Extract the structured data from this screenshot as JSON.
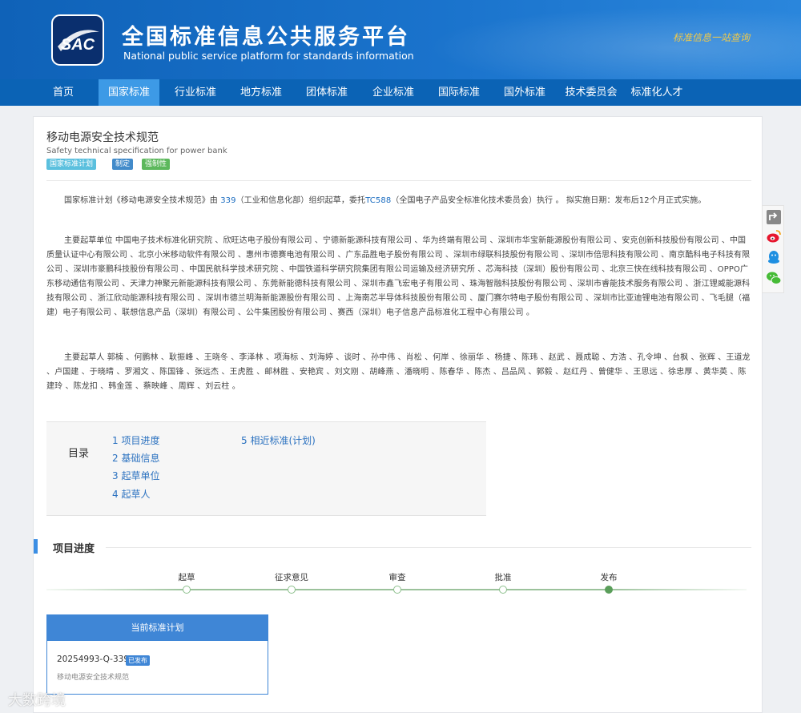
{
  "header": {
    "logo_text": "SAC",
    "title": "全国标准信息公共服务平台",
    "subtitle": "National public service platform  for standards information",
    "slogan": "标准信息一站查询"
  },
  "nav": {
    "items": [
      "首页",
      "国家标准",
      "行业标准",
      "地方标准",
      "团体标准",
      "企业标准",
      "国际标准",
      "国外标准",
      "技术委员会",
      "标准化人才"
    ],
    "active_index": 1
  },
  "standard": {
    "title": "移动电源安全技术规范",
    "title_en": "Safety technical specification for power bank",
    "tags": [
      "国家标准计划",
      "制定",
      "强制性"
    ],
    "tag_colors": [
      "#5bc0de",
      "#428bca",
      "#5cb85c"
    ]
  },
  "intro": {
    "p1_a": "国家标准计划《移动电源安全技术规范》由 ",
    "p1_link1": "339",
    "p1_b": "（工业和信息化部）组织起草，委托",
    "p1_link2": "TC588",
    "p1_c": "（全国电子产品安全标准化技术委员会）执行 。 拟实施日期：发布后12个月正式实施。",
    "units": "主要起草单位 中国电子技术标准化研究院 、欣旺达电子股份有限公司 、宁德新能源科技有限公司 、华为终端有限公司 、深圳市华宝新能源股份有限公司 、安克创新科技股份有限公司 、中国质量认证中心有限公司 、北京小米移动软件有限公司 、惠州市德赛电池有限公司 、广东品胜电子股份有限公司 、深圳市绿联科技股份有限公司 、深圳市倍思科技有限公司 、南京酷科电子科技有限公司 、深圳市豪鹏科技股份有限公司 、中国民航科学技术研究院 、中国铁道科学研究院集团有限公司运输及经济研究所 、芯海科技（深圳）股份有限公司 、北京三快在线科技有限公司 、OPPO广东移动通信有限公司 、天津力神聚元新能源科技有限公司 、东莞新能德科技有限公司 、深圳市鑫飞宏电子有限公司 、珠海智融科技股份有限公司 、深圳市睿能技术服务有限公司 、浙江锂威能源科技有限公司 、浙江欣动能源科技有限公司 、深圳市德兰明海新能源股份有限公司 、上海南芯半导体科技股份有限公司 、厦门赛尔特电子股份有限公司 、深圳市比亚迪锂电池有限公司 、飞毛腿（福建）电子有限公司 、联想信息产品（深圳）有限公司 、公牛集团股份有限公司 、赛西（深圳）电子信息产品标准化工程中心有限公司 。",
    "people": "主要起草人 郭楠 、何鹏林 、耿振峰 、王晓冬 、李泽林 、项海标 、刘海婷 、谈时 、孙中伟 、肖松 、何岸 、徐丽华 、杨捷 、陈玮 、赵武 、聂成聪 、方浩 、孔令坤 、台枫 、张辉 、王道龙 、卢国建 、于晓晴 、罗湘文 、陈国锋 、张远杰 、王虎胜 、邮林胜 、安艳宾 、刘文刚 、胡峰燕 、潘晓明 、陈春华 、陈杰 、吕品风 、郭毅 、赵红丹 、曾健华 、王思远 、徐忠厚 、黄华英 、陈建玲 、陈龙扣 、韩金莲 、蔡映峰 、周辉 、刘云柱 。"
  },
  "toc": {
    "label": "目录",
    "items": [
      "1  项目进度",
      "2  基础信息",
      "3  起草单位",
      "4  起草人",
      "5  相近标准(计划)"
    ]
  },
  "progress": {
    "section_title": "项目进度",
    "steps": [
      "起草",
      "征求意见",
      "审查",
      "批准",
      "发布"
    ],
    "current_step_index": 4
  },
  "plan_card": {
    "header": "当前标准计划",
    "code": "20254993-Q-339",
    "badge": "已发布",
    "name": "移动电源安全技术规范"
  },
  "share": {
    "icons": [
      "share-icon",
      "weibo-icon",
      "qq-icon",
      "wechat-icon"
    ]
  },
  "watermark": "大数跨境"
}
